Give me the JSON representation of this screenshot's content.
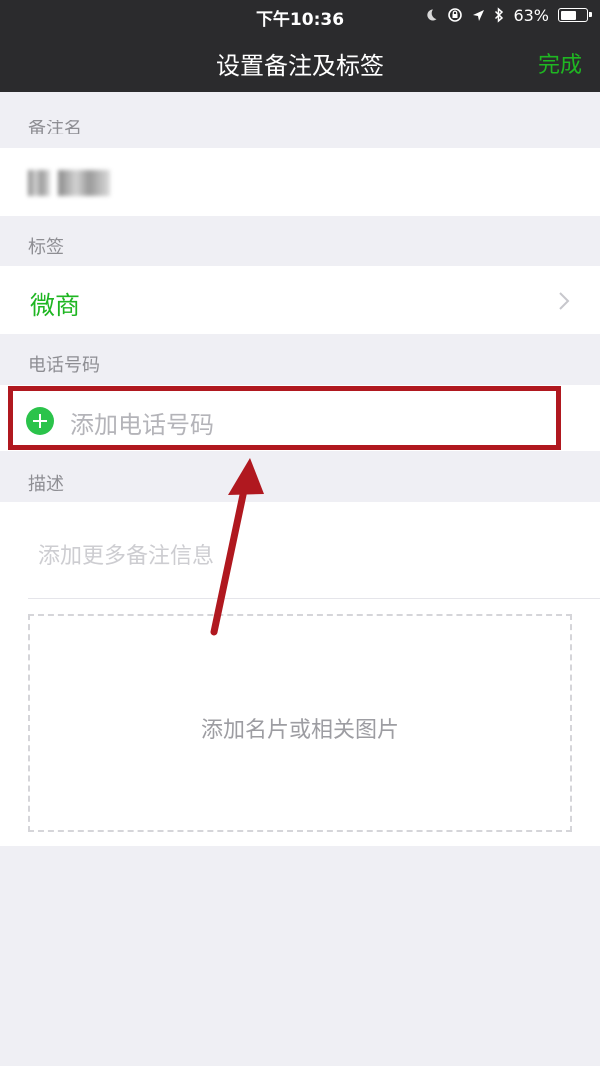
{
  "status_bar": {
    "time": "下午10:36",
    "battery_percent": "63%",
    "battery_level": 0.63,
    "icons": [
      "moon-icon",
      "rotation-lock-icon",
      "location-icon",
      "bluetooth-icon",
      "battery-icon"
    ]
  },
  "nav": {
    "title": "设置备注及标签",
    "done_label": "完成"
  },
  "remark": {
    "section_label": "备注名",
    "value_blurred": true
  },
  "tags": {
    "section_label": "标签",
    "value": "微商",
    "icon": "chevron-right-icon"
  },
  "phone": {
    "section_label": "电话号码",
    "add_label": "添加电话号码",
    "icon": "add-circle-icon"
  },
  "description": {
    "section_label": "描述",
    "placeholder": "添加更多备注信息",
    "image_placeholder": "添加名片或相关图片"
  },
  "annotation": {
    "highlight_color": "#b0181f"
  },
  "colors": {
    "accent_green": "#1fb622",
    "nav_background": "#2b2b2d",
    "page_background": "#efeff4"
  }
}
